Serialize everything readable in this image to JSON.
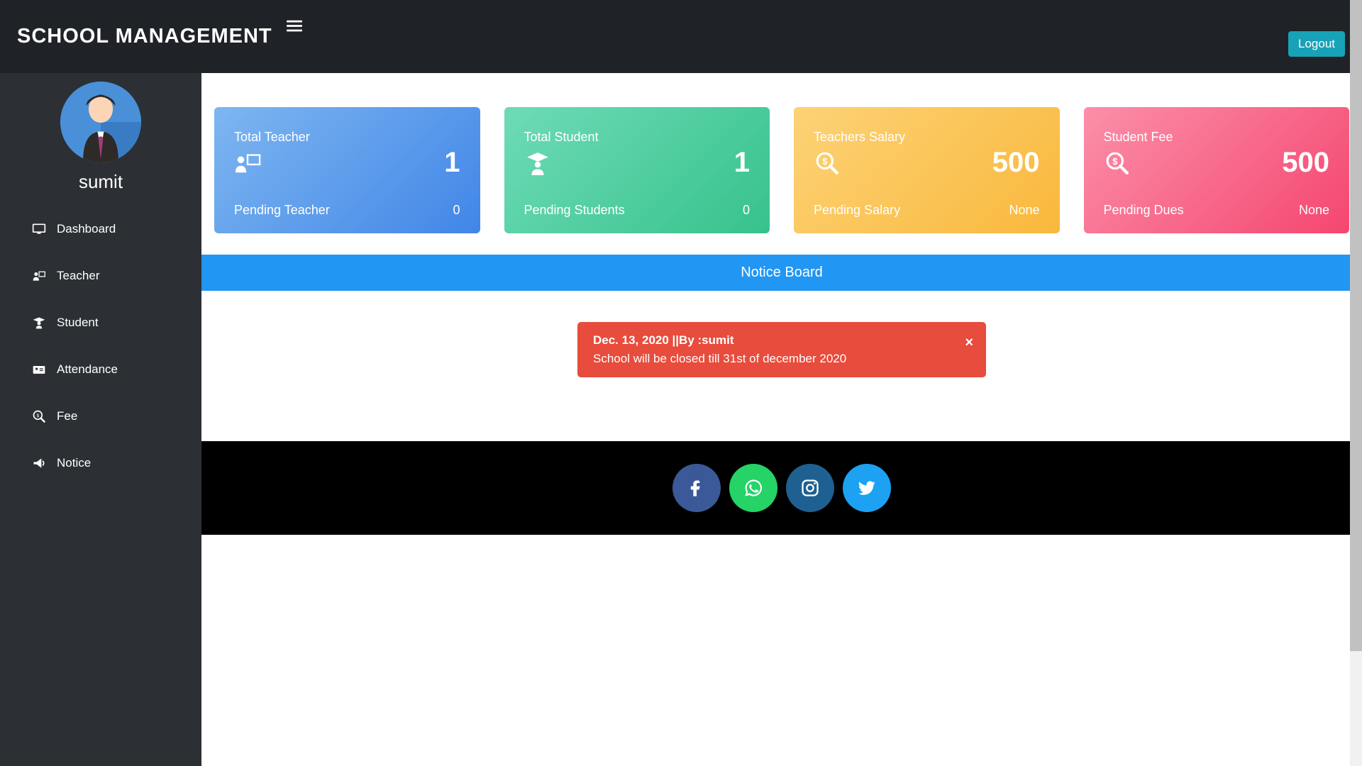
{
  "header": {
    "title": "SCHOOL MANAGEMENT",
    "logout": "Logout"
  },
  "sidebar": {
    "username": "sumit",
    "items": [
      {
        "label": "Dashboard",
        "icon": "monitor"
      },
      {
        "label": "Teacher",
        "icon": "teacher"
      },
      {
        "label": "Student",
        "icon": "graduate"
      },
      {
        "label": "Attendance",
        "icon": "card"
      },
      {
        "label": "Fee",
        "icon": "search-dollar"
      },
      {
        "label": "Notice",
        "icon": "bullhorn"
      }
    ]
  },
  "cards": [
    {
      "title": "Total Teacher",
      "value": "1",
      "sub_label": "Pending Teacher",
      "sub_value": "0",
      "icon": "teacher"
    },
    {
      "title": "Total Student",
      "value": "1",
      "sub_label": "Pending Students",
      "sub_value": "0",
      "icon": "graduate"
    },
    {
      "title": "Teachers Salary",
      "value": "500",
      "sub_label": "Pending Salary",
      "sub_value": "None",
      "icon": "search-dollar"
    },
    {
      "title": "Student Fee",
      "value": "500",
      "sub_label": "Pending Dues",
      "sub_value": "None",
      "icon": "search-dollar"
    }
  ],
  "notice_board": {
    "heading": "Notice Board",
    "notices": [
      {
        "meta": "Dec. 13, 2020 ||By :sumit",
        "text": "School will be closed till 31st of december 2020"
      }
    ],
    "close": "×"
  }
}
